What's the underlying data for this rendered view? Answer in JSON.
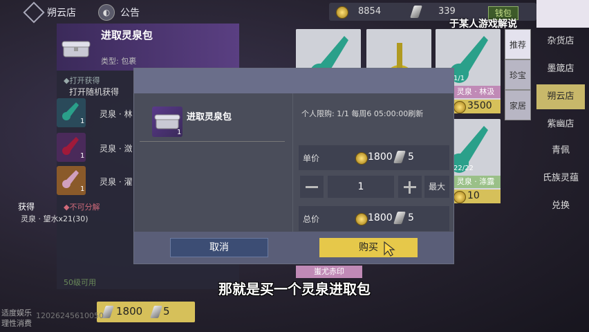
{
  "top": {
    "back_label": "朔云店",
    "notice_label": "公告",
    "jade_amount": "8854",
    "silver_amount": "339",
    "wallet_label": "钱包",
    "watermark": "于某人游戏解说"
  },
  "item_detail": {
    "title": "进取灵泉包",
    "type": "类型: 包裹",
    "open_get": "◆打开获得",
    "open_random": "打开随机获得",
    "contents": [
      {
        "name": "灵泉 · 林",
        "count": "1",
        "color": "#2a7a6a"
      },
      {
        "name": "灵泉 · 潋",
        "count": "1",
        "color": "#7a1a3a"
      },
      {
        "name": "灵泉 · 濯",
        "count": "1",
        "color": "#8a6a3a"
      }
    ],
    "cannot_split": "◆不可分解",
    "level_req": "50级可用",
    "obtain_label": "获得",
    "obtain_item": "灵泉 · 望水x21(30)",
    "bottom_price": "1800",
    "bottom_silver": "5"
  },
  "bottom_left": {
    "line1": "适度娱乐",
    "line2": "理性消费",
    "id_text": "12026245610050"
  },
  "shop_cards": {
    "r3_count": "1/1",
    "r3_label": "灵泉 · 林汲",
    "r3_price": "3500",
    "r3b_count": "22/22",
    "r3b_label": "灵泉 · 涤露",
    "r3b_price": "10",
    "bottom_label": "蚩尤赤印"
  },
  "category_tabs": [
    "推荐",
    "珍宝",
    "家居"
  ],
  "stores": [
    "杂货店",
    "墨箴店",
    "朔云店",
    "紫幽店",
    "青佩",
    "氏族灵蕴",
    "兑换"
  ],
  "active_store": "朔云店",
  "modal": {
    "item_name": "进取灵泉包",
    "item_count": "1",
    "limit": "个人限购: 1/1 每周6 05:00:00刷新",
    "unit_label": "单价",
    "unit_price": "1800",
    "unit_silver": "5",
    "quantity": "1",
    "max_label": "最大",
    "total_label": "总价",
    "total_price": "1800",
    "total_silver": "5",
    "cancel_label": "取消",
    "buy_label": "购买"
  },
  "subtitle": "那就是买一个灵泉进取包"
}
